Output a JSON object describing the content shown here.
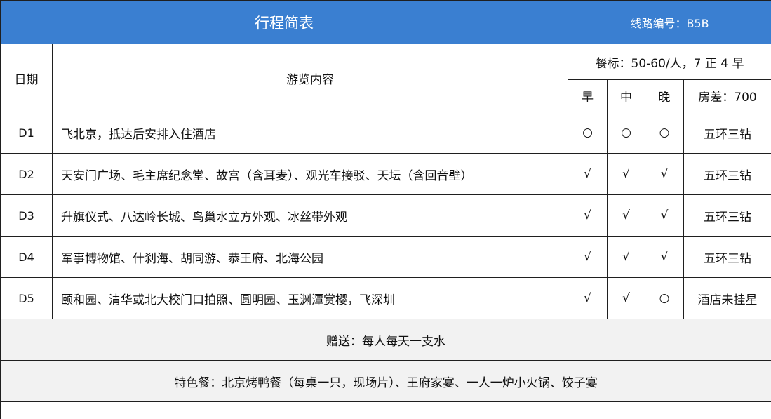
{
  "header": {
    "title": "行程简表",
    "route_code": "线路编号：B5B"
  },
  "columns": {
    "date": "日期",
    "content": "游览内容",
    "meal_standard": "餐标：50-60/人，7 正 4 早",
    "breakfast": "早",
    "lunch": "中",
    "dinner": "晚",
    "room_diff": "房差：700"
  },
  "days": [
    {
      "day": "D1",
      "content": "飞北京，抵达后安排入住酒店",
      "breakfast": "○",
      "lunch": "○",
      "dinner": "○",
      "hotel": "五环三钻"
    },
    {
      "day": "D2",
      "content": "天安门广场、毛主席纪念堂、故宫（含耳麦）、观光车接驳、天坛（含回音壁）",
      "breakfast": "√",
      "lunch": "√",
      "dinner": "√",
      "hotel": "五环三钻"
    },
    {
      "day": "D3",
      "content": "升旗仪式、八达岭长城、鸟巢水立方外观、冰丝带外观",
      "breakfast": "√",
      "lunch": "√",
      "dinner": "√",
      "hotel": "五环三钻"
    },
    {
      "day": "D4",
      "content": "军事博物馆、什刹海、胡同游、恭王府、北海公园",
      "breakfast": "√",
      "lunch": "√",
      "dinner": "√",
      "hotel": "五环三钻"
    },
    {
      "day": "D5",
      "content": "颐和园、清华或北大校门口拍照、圆明园、玉渊潭赏樱，飞深圳",
      "breakfast": "√",
      "lunch": "√",
      "dinner": "○",
      "hotel": "酒店未挂星"
    }
  ],
  "gift": "赠送：每人每天一支水",
  "special_meals": "特色餐：北京烤鸭餐（每桌一只，现场片）、王府家宴、一人一炉小火锅、饺子宴",
  "colors": {
    "header_bg": "#3a7fd1",
    "header_text": "#ffffff",
    "footer_bg": "#f2f2f2",
    "border": "#1f1f1f"
  }
}
